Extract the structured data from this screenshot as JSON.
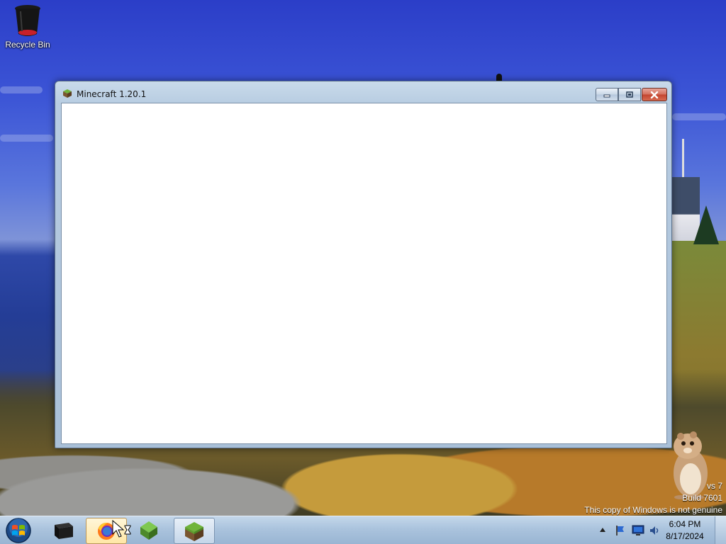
{
  "desktop": {
    "icons": [
      {
        "label": "Recycle Bin",
        "icon": "recycle-bin-icon"
      }
    ]
  },
  "window": {
    "title": "Minecraft 1.20.1",
    "icon": "minecraft-grass-block-icon",
    "controls": {
      "minimize": "minimize-icon",
      "maximize": "restore-icon",
      "close": "close-icon"
    },
    "client_color": "#ffffff"
  },
  "watermark": {
    "line1": "vs 7",
    "line2": "Build 7601",
    "line3": "This copy of Windows is not genuine"
  },
  "taskbar": {
    "start_icon": "windows-start-orb-icon",
    "buttons": [
      {
        "name": "taskbar-app-black-box",
        "icon": "black-box-icon"
      },
      {
        "name": "taskbar-firefox",
        "icon": "firefox-icon",
        "state": "hover"
      },
      {
        "name": "taskbar-minecraft-launcher",
        "icon": "green-diamond-block-icon"
      },
      {
        "name": "taskbar-minecraft",
        "icon": "minecraft-grass-block-icon",
        "state": "active"
      }
    ],
    "tray": {
      "icons": [
        "show-hidden-icons-arrow",
        "action-center-flag-icon",
        "network-icon",
        "speaker-icon"
      ],
      "time": "6:04 PM",
      "date": "8/17/2024"
    }
  },
  "colors": {
    "taskbar": "#aac3dd",
    "window_frame": "#b8cde2",
    "close_button": "#c2432e"
  }
}
